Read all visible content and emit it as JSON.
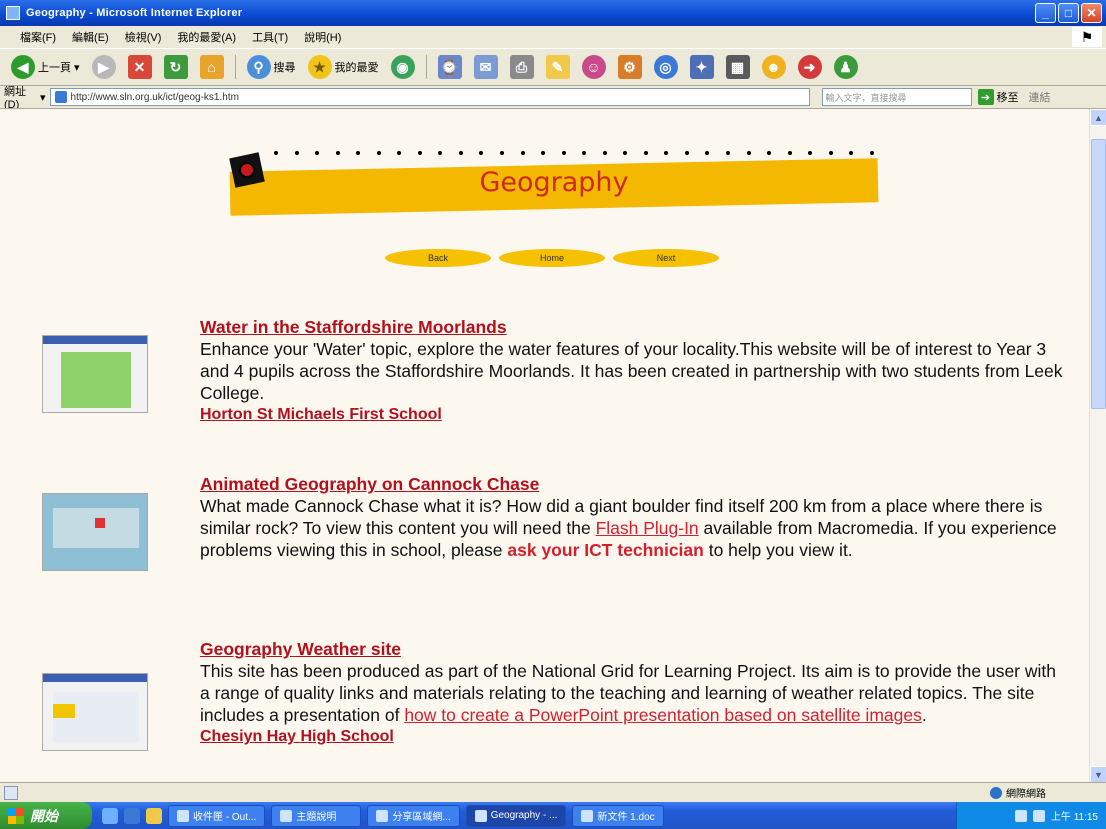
{
  "window": {
    "title": "Geography - Microsoft Internet Explorer",
    "min": "_",
    "max": "□",
    "close": "✕"
  },
  "menu": [
    "檔案(F)",
    "編輯(E)",
    "檢視(V)",
    "我的最愛(A)",
    "工具(T)",
    "說明(H)"
  ],
  "toolbar": {
    "back_label": "上一頁",
    "search_label": "搜尋",
    "favorites_label": "我的最愛"
  },
  "address": {
    "label": "網址(D)",
    "url": "http://www.sln.org.uk/ict/geog-ks1.htm",
    "search_placeholder": "輸入文字，直接搜尋",
    "go_label": "移至",
    "links_label": "連結"
  },
  "page": {
    "banner_title": "Geography",
    "nav": [
      "Back",
      "Home",
      "Next"
    ],
    "entries": [
      {
        "title": "Water in the Staffordshire Moorlands",
        "text": "Enhance your 'Water' topic, explore the water features of your locality.This website will be of interest to Year 3 and 4 pupils across the Staffordshire Moorlands. It has been created in partnership with two students from Leek College.",
        "sub": "Horton St Michaels First School"
      },
      {
        "title": "Animated Geography on Cannock Chase",
        "text_a": "What made Cannock Chase what it is? How did a giant boulder find itself 200 km from a place where there is similar rock? To view this content you will need the ",
        "link_a": "Flash Plug-In",
        "text_b": "  available from Macromedia. If you experience problems viewing this in school, please ",
        "link_b": "ask your ICT technician",
        "text_c": " to help you view it."
      },
      {
        "title": "Geography Weather site",
        "text": "This site has been produced as part of the National Grid for Learning Project. Its aim is to provide the user with a range of quality links and materials relating to the teaching and learning of weather related topics. The site includes a presentation of ",
        "link": "how to create a PowerPoint presentation based on satellite images",
        "text_end": ".",
        "sub": "Chesiyn Hay High School"
      }
    ]
  },
  "status": {
    "zone": "網際網路"
  },
  "taskbar": {
    "start": "開始",
    "tasks": [
      "收件匣 - Out...",
      "主題說明",
      "分享區域網...",
      "Geography - ...",
      "新文件 1.doc"
    ],
    "clock": "上午 11:15"
  },
  "colors": {
    "accent_red": "#b3101d",
    "banner_yellow": "#f5b800",
    "page_bg": "#fcf8f0"
  }
}
